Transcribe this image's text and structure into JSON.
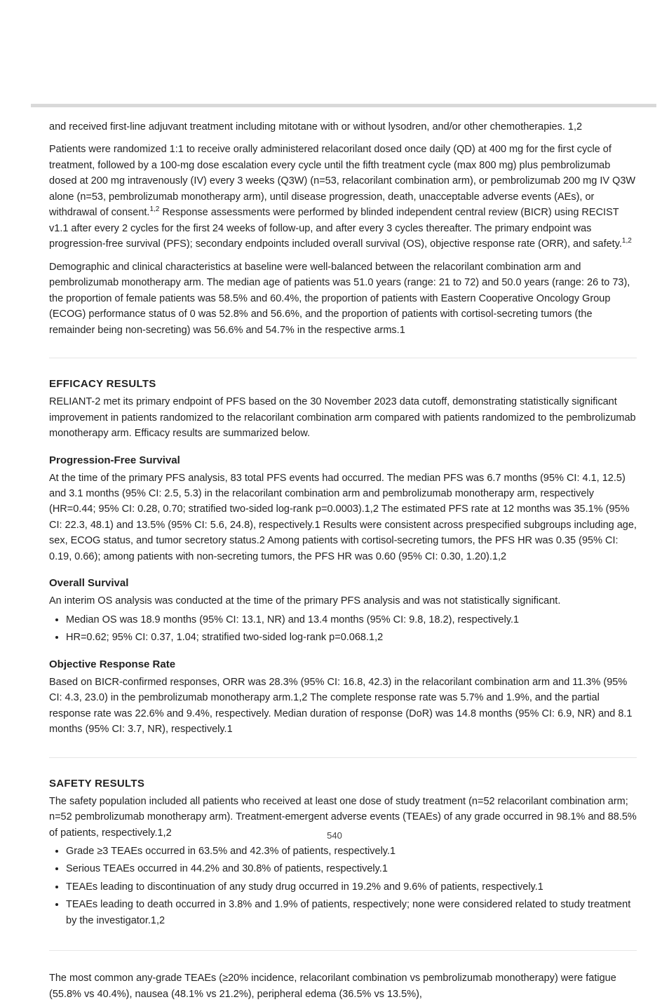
{
  "footer": {
    "page_number": "540"
  },
  "block0": {
    "p1": "and received first-line adjuvant treatment including mitotane with or without lysodren, and/or other chemotherapies. 1,2",
    "p2_a": "Patients were randomized 1:1 to receive orally administered relacorilant dosed once daily (QD) at 400 mg for the first cycle of treatment, followed by a 100-mg dose escalation every cycle until the fifth treatment cycle (max 800 mg) plus pembrolizumab dosed at 200 mg intravenously (IV) every 3 weeks (Q3W) (n=53, relacorilant combination arm), or pembrolizumab 200 mg IV Q3W alone (n=53, pembrolizumab monotherapy arm), until disease progression, death, unacceptable adverse events (AEs), or withdrawal of consent.",
    "p2_sup": "1,2",
    "p2_b": " Response assessments were performed by blinded independent central review (BICR) using RECIST v1.1 after every 2 cycles for the first 24 weeks of follow-up, and after every 3 cycles thereafter. The primary endpoint was progression-free survival (PFS); secondary endpoints included overall survival (OS), objective response rate (ORR), and safety.",
    "p2_sup2": "1,2",
    "p3": "Demographic and clinical characteristics at baseline were well-balanced between the relacorilant combination arm and pembrolizumab monotherapy arm. The median age of patients was 51.0 years (range: 21 to 72) and 50.0 years (range: 26 to 73), the proportion of female patients was 58.5% and 60.4%, the proportion of patients with Eastern Cooperative Oncology Group (ECOG) performance status of 0 was 52.8% and 56.6%, and the proportion of patients with cortisol-secreting tumors (the remainder being non-secreting) was 56.6% and 54.7% in the respective arms.1"
  },
  "block1": {
    "h": "Efficacy Results",
    "p1": "RELIANT-2 met its primary endpoint of PFS based on the 30 November 2023 data cutoff, demonstrating statistically significant improvement in patients randomized to the relacorilant combination arm compared with patients randomized to the pembrolizumab monotherapy arm. Efficacy results are summarized below.",
    "sub1": "Progression-Free Survival",
    "p2": "At the time of the primary PFS analysis, 83 total PFS events had occurred. The median PFS was 6.7 months (95% CI: 4.1, 12.5) and 3.1 months (95% CI: 2.5, 5.3) in the relacorilant combination arm and pembrolizumab monotherapy arm, respectively (HR=0.44; 95% CI: 0.28, 0.70; stratified two-sided log-rank p=0.0003).1,2 The estimated PFS rate at 12 months was 35.1% (95% CI: 22.3, 48.1) and 13.5% (95% CI: 5.6, 24.8), respectively.1 Results were consistent across prespecified subgroups including age, sex, ECOG status, and tumor secretory status.2 Among patients with cortisol-secreting tumors, the PFS HR was 0.35 (95% CI: 0.19, 0.66); among patients with non-secreting tumors, the PFS HR was 0.60 (95% CI: 0.30, 1.20).1,2",
    "sub2": "Overall Survival",
    "p3": "An interim OS analysis was conducted at the time of the primary PFS analysis and was not statistically significant.",
    "li1": "Median OS was 18.9 months (95% CI: 13.1, NR) and 13.4 months (95% CI: 9.8, 18.2), respectively.1",
    "li2": "HR=0.62; 95% CI: 0.37, 1.04; stratified two-sided log-rank p=0.068.1,2",
    "sub3": "Objective Response Rate",
    "p4": "Based on BICR-confirmed responses, ORR was 28.3% (95% CI: 16.8, 42.3) in the relacorilant combination arm and 11.3% (95% CI: 4.3, 23.0) in the pembrolizumab monotherapy arm.1,2 The complete response rate was 5.7% and 1.9%, and the partial response rate was 22.6% and 9.4%, respectively. Median duration of response (DoR) was 14.8 months (95% CI: 6.9, NR) and 8.1 months (95% CI: 3.7, NR), respectively.1"
  },
  "block2": {
    "h": "Safety Results",
    "p1": "The safety population included all patients who received at least one dose of study treatment (n=52 relacorilant combination arm; n=52 pembrolizumab monotherapy arm). Treatment-emergent adverse events (TEAEs) of any grade occurred in 98.1% and 88.5% of patients, respectively.1,2",
    "li1": "Grade ≥3 TEAEs occurred in 63.5% and 42.3% of patients, respectively.1",
    "li2": "Serious TEAEs occurred in 44.2% and 30.8% of patients, respectively.1",
    "li3": "TEAEs leading to discontinuation of any study drug occurred in 19.2% and 9.6% of patients, respectively.1",
    "li4": "TEAEs leading to death occurred in 3.8% and 1.9% of patients, respectively; none were considered related to study treatment by the investigator.1,2",
    "p2": "The most common any-grade TEAEs (≥20% incidence, relacorilant combination vs pembrolizumab monotherapy) were fatigue (55.8% vs 40.4%), nausea (48.1% vs 21.2%), peripheral edema (36.5% vs 13.5%),"
  }
}
